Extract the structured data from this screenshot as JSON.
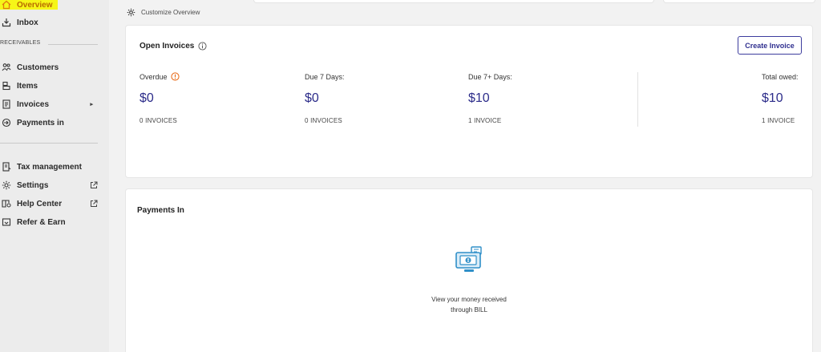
{
  "sidebar": {
    "items": [
      {
        "label": "Overview",
        "icon": "home-icon"
      },
      {
        "label": "Inbox",
        "icon": "inbox-icon"
      },
      {
        "label": "Customers",
        "icon": "customers-icon"
      },
      {
        "label": "Items",
        "icon": "items-icon"
      },
      {
        "label": "Invoices",
        "icon": "invoices-icon"
      },
      {
        "label": "Payments in",
        "icon": "payments-in-icon"
      },
      {
        "label": "Tax management",
        "icon": "tax-icon"
      },
      {
        "label": "Settings",
        "icon": "gear-icon"
      },
      {
        "label": "Help Center",
        "icon": "help-icon"
      },
      {
        "label": "Refer & Earn",
        "icon": "gift-icon"
      }
    ],
    "section_receivables": "RECEIVABLES",
    "invoices_caret": "▸",
    "highlight_color": "#f6f618"
  },
  "customize_label": "Customize Overview",
  "open_invoices": {
    "title": "Open Invoices",
    "create_button": "Create Invoice",
    "stats": [
      {
        "label": "Overdue",
        "amount": "$0",
        "count": "0 INVOICES"
      },
      {
        "label": "Due 7 Days:",
        "amount": "$0",
        "count": "0 INVOICES"
      },
      {
        "label": "Due 7+ Days:",
        "amount": "$10",
        "count": "1 INVOICE"
      },
      {
        "label": "Total owed:",
        "amount": "$10",
        "count": "1 INVOICE"
      }
    ]
  },
  "payments_in": {
    "title": "Payments In",
    "empty_line1": "View your money received",
    "empty_line2": "through BILL"
  },
  "colors": {
    "accent": "#2c2c8a",
    "alert": "#e8650f",
    "empty_icon": "#2f8fc8"
  }
}
